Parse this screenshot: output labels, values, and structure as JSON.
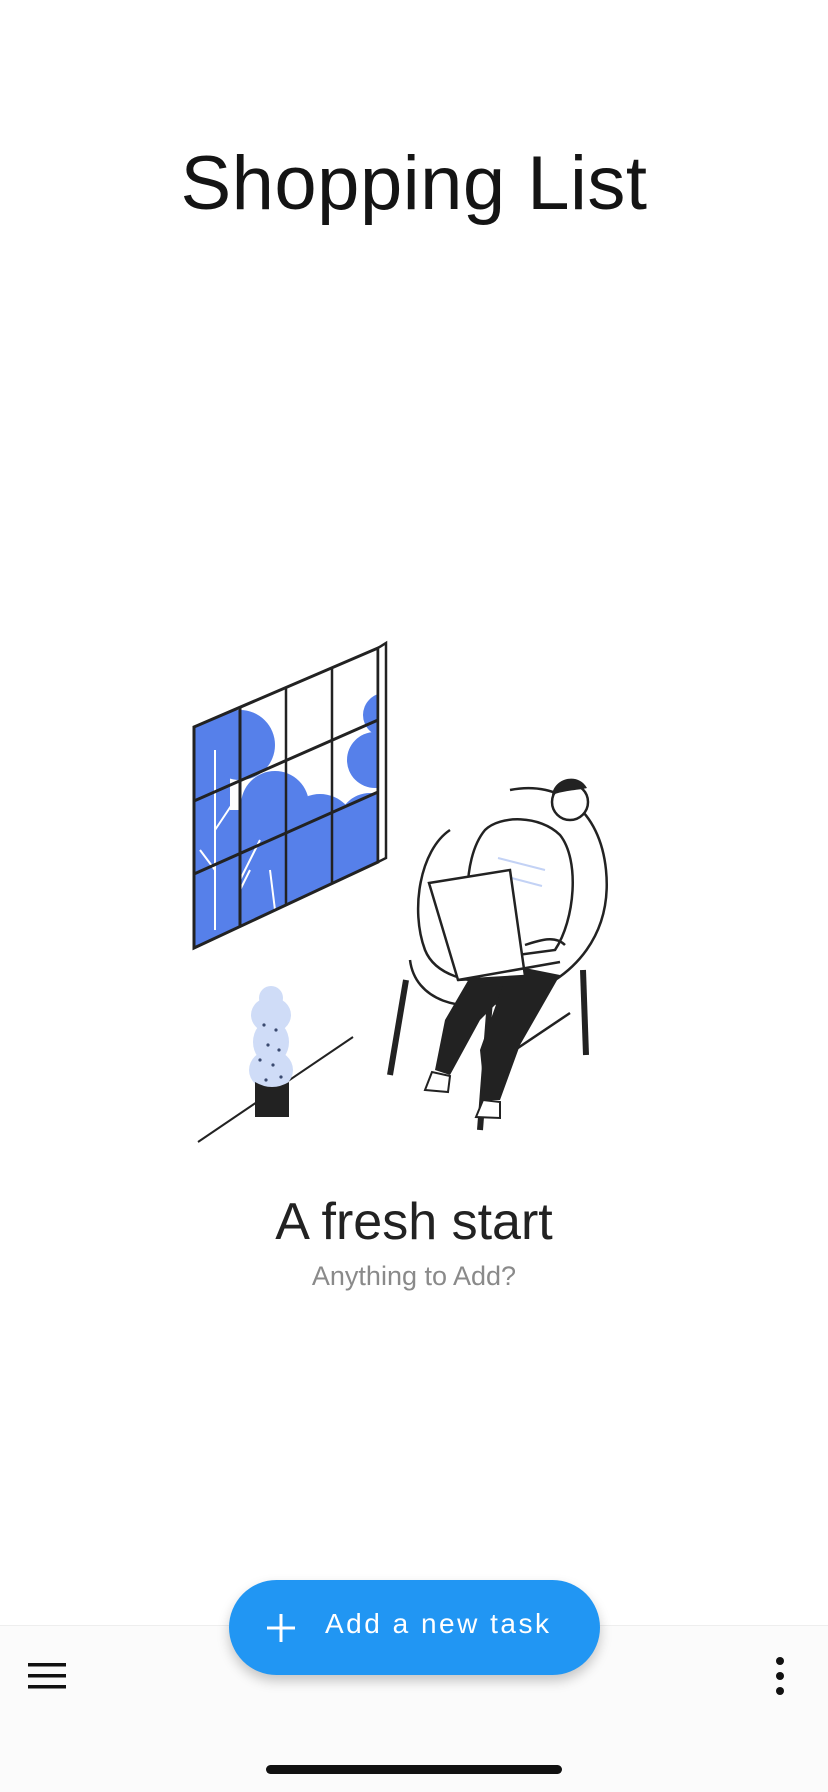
{
  "header": {
    "title": "Shopping List"
  },
  "empty_state": {
    "title": "A fresh start",
    "subtitle": "Anything to Add?",
    "illustration": "person-on-laptop-in-chair-by-window"
  },
  "fab": {
    "label": "Add a new task",
    "icon": "plus-icon",
    "color": "#2196f3"
  },
  "bottom_bar": {
    "left_icon": "menu-icon",
    "right_icon": "more-vertical-icon"
  },
  "colors": {
    "accent": "#2196f3",
    "illustration_blue": "#5680ea",
    "illustration_dark": "#222222",
    "text_primary": "#141414",
    "text_secondary": "#8a8a8a"
  }
}
